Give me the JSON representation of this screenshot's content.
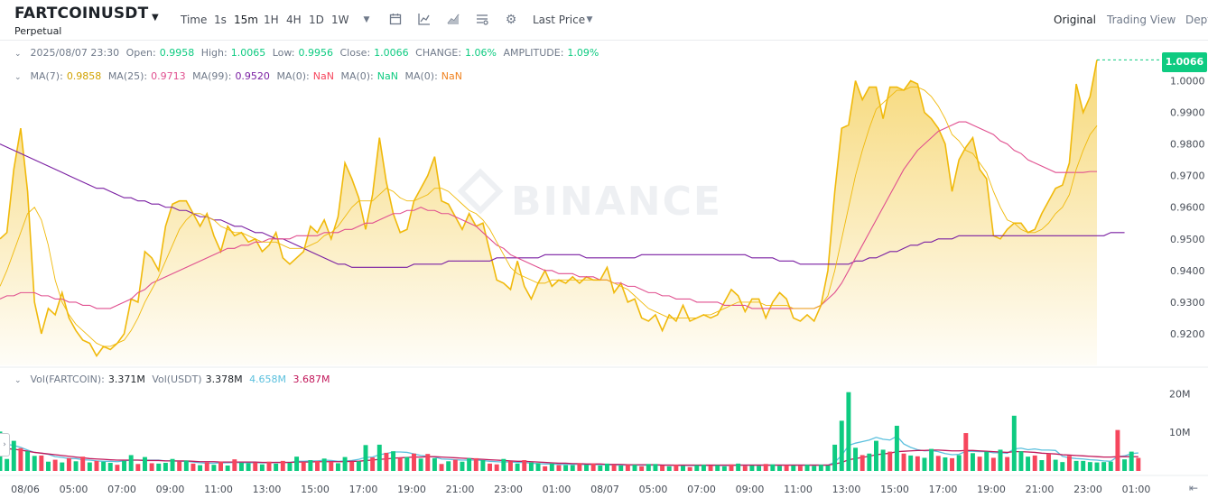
{
  "header": {
    "symbol": "FARTCOINUSDT",
    "contract": "Perpetual",
    "intervals": [
      "Time",
      "1s",
      "15m",
      "1H",
      "4H",
      "1D",
      "1W"
    ],
    "active_interval": "15m",
    "price_type": "Last Price",
    "views": [
      "Original",
      "Trading View",
      "Dept"
    ],
    "active_view": "Original"
  },
  "ohlc": {
    "date": "2025/08/07 23:30",
    "open_label": "Open:",
    "open": "0.9958",
    "high_label": "High:",
    "high": "1.0065",
    "low_label": "Low:",
    "low": "0.9956",
    "close_label": "Close:",
    "close": "1.0066",
    "change_label": "CHANGE:",
    "change": "1.06%",
    "amplitude_label": "AMPLITUDE:",
    "amplitude": "1.09%"
  },
  "ma": {
    "ma7_label": "MA(7):",
    "ma7": "0.9858",
    "ma25_label": "MA(25):",
    "ma25": "0.9713",
    "ma99_label": "MA(99):",
    "ma99": "0.9520",
    "ma0a_label": "MA(0):",
    "ma0a": "NaN",
    "ma0b_label": "MA(0):",
    "ma0b": "NaN",
    "ma0c_label": "MA(0):",
    "ma0c": "NaN"
  },
  "volume": {
    "label": "Vol(FARTCOIN):",
    "value": "3.371M",
    "usdt_label": "Vol(USDT)",
    "usdt_value": "3.378M",
    "ma1": "4.658M",
    "ma2": "3.687M"
  },
  "current_price": "1.0066",
  "watermark": "BINANCE",
  "colors": {
    "up": "#0ecb81",
    "down": "#f6465d",
    "area_line": "#f0b90b",
    "ma7": "#f0b90b",
    "ma25": "#e04f8f",
    "ma99": "#7a1fa2",
    "vol_ma1": "#5bc0de",
    "vol_ma2": "#c2185b"
  },
  "chart_data": {
    "type": "area",
    "y_ticks": [
      "1.0000",
      "0.9900",
      "0.9800",
      "0.9700",
      "0.9600",
      "0.9500",
      "0.9400",
      "0.9300",
      "0.9200"
    ],
    "ylim": [
      0.91,
      1.007
    ],
    "x_ticks": [
      "08/06",
      "05:00",
      "07:00",
      "09:00",
      "11:00",
      "13:00",
      "15:00",
      "17:00",
      "19:00",
      "21:00",
      "23:00",
      "01:00",
      "08/07",
      "05:00",
      "07:00",
      "09:00",
      "11:00",
      "13:00",
      "15:00",
      "17:00",
      "19:00",
      "21:00",
      "23:00",
      "01:00"
    ],
    "vol_ticks": [
      "20M",
      "10M"
    ],
    "vol_max": 25,
    "price": [
      0.95,
      0.952,
      0.972,
      0.985,
      0.965,
      0.93,
      0.92,
      0.928,
      0.926,
      0.933,
      0.925,
      0.921,
      0.918,
      0.917,
      0.913,
      0.916,
      0.915,
      0.917,
      0.92,
      0.931,
      0.93,
      0.946,
      0.944,
      0.94,
      0.954,
      0.961,
      0.962,
      0.962,
      0.958,
      0.954,
      0.958,
      0.951,
      0.946,
      0.954,
      0.951,
      0.952,
      0.949,
      0.95,
      0.946,
      0.948,
      0.952,
      0.944,
      0.942,
      0.944,
      0.946,
      0.954,
      0.952,
      0.956,
      0.95,
      0.957,
      0.974,
      0.969,
      0.963,
      0.953,
      0.964,
      0.982,
      0.968,
      0.958,
      0.952,
      0.953,
      0.962,
      0.966,
      0.97,
      0.976,
      0.962,
      0.961,
      0.957,
      0.953,
      0.958,
      0.954,
      0.955,
      0.946,
      0.937,
      0.936,
      0.934,
      0.943,
      0.935,
      0.931,
      0.936,
      0.94,
      0.935,
      0.937,
      0.936,
      0.938,
      0.936,
      0.938,
      0.937,
      0.937,
      0.941,
      0.933,
      0.936,
      0.93,
      0.931,
      0.925,
      0.924,
      0.926,
      0.921,
      0.926,
      0.924,
      0.929,
      0.924,
      0.925,
      0.926,
      0.925,
      0.926,
      0.93,
      0.934,
      0.932,
      0.927,
      0.931,
      0.931,
      0.925,
      0.93,
      0.933,
      0.931,
      0.925,
      0.924,
      0.926,
      0.924,
      0.929,
      0.94,
      0.965,
      0.985,
      0.986,
      1.0,
      0.994,
      0.998,
      0.998,
      0.988,
      0.998,
      0.998,
      0.997,
      1.0,
      0.999,
      0.99,
      0.988,
      0.985,
      0.98,
      0.965,
      0.975,
      0.979,
      0.982,
      0.972,
      0.969,
      0.951,
      0.95,
      0.953,
      0.955,
      0.955,
      0.952,
      0.953,
      0.958,
      0.962,
      0.966,
      0.967,
      0.974,
      0.999,
      0.99,
      0.995,
      1.0066
    ],
    "ma7": [
      0.935,
      0.94,
      0.946,
      0.952,
      0.958,
      0.96,
      0.956,
      0.948,
      0.937,
      0.93,
      0.926,
      0.923,
      0.921,
      0.919,
      0.917,
      0.916,
      0.916,
      0.917,
      0.918,
      0.921,
      0.925,
      0.93,
      0.934,
      0.938,
      0.943,
      0.948,
      0.953,
      0.956,
      0.958,
      0.958,
      0.957,
      0.956,
      0.954,
      0.953,
      0.952,
      0.952,
      0.951,
      0.95,
      0.949,
      0.949,
      0.949,
      0.948,
      0.947,
      0.947,
      0.947,
      0.948,
      0.949,
      0.951,
      0.952,
      0.954,
      0.957,
      0.96,
      0.962,
      0.962,
      0.962,
      0.964,
      0.966,
      0.965,
      0.963,
      0.962,
      0.962,
      0.963,
      0.964,
      0.966,
      0.966,
      0.965,
      0.963,
      0.961,
      0.959,
      0.958,
      0.956,
      0.953,
      0.949,
      0.945,
      0.941,
      0.939,
      0.938,
      0.937,
      0.936,
      0.936,
      0.937,
      0.937,
      0.937,
      0.937,
      0.937,
      0.937,
      0.937,
      0.937,
      0.937,
      0.936,
      0.935,
      0.934,
      0.932,
      0.93,
      0.928,
      0.927,
      0.926,
      0.925,
      0.925,
      0.925,
      0.925,
      0.925,
      0.926,
      0.926,
      0.927,
      0.928,
      0.929,
      0.93,
      0.93,
      0.93,
      0.93,
      0.929,
      0.929,
      0.929,
      0.929,
      0.928,
      0.928,
      0.928,
      0.928,
      0.929,
      0.932,
      0.94,
      0.95,
      0.96,
      0.97,
      0.978,
      0.985,
      0.991,
      0.993,
      0.995,
      0.997,
      0.997,
      0.998,
      0.998,
      0.997,
      0.995,
      0.992,
      0.988,
      0.983,
      0.981,
      0.978,
      0.977,
      0.974,
      0.971,
      0.965,
      0.96,
      0.956,
      0.955,
      0.953,
      0.952,
      0.952,
      0.953,
      0.955,
      0.958,
      0.96,
      0.964,
      0.972,
      0.978,
      0.983,
      0.9858
    ],
    "ma25": [
      0.931,
      0.932,
      0.932,
      0.933,
      0.933,
      0.933,
      0.932,
      0.932,
      0.931,
      0.931,
      0.93,
      0.93,
      0.929,
      0.929,
      0.928,
      0.928,
      0.928,
      0.929,
      0.93,
      0.931,
      0.933,
      0.934,
      0.936,
      0.937,
      0.938,
      0.939,
      0.94,
      0.941,
      0.942,
      0.943,
      0.944,
      0.945,
      0.946,
      0.947,
      0.947,
      0.948,
      0.948,
      0.949,
      0.949,
      0.95,
      0.95,
      0.95,
      0.95,
      0.951,
      0.951,
      0.951,
      0.951,
      0.952,
      0.952,
      0.952,
      0.953,
      0.953,
      0.954,
      0.955,
      0.955,
      0.956,
      0.957,
      0.958,
      0.958,
      0.959,
      0.959,
      0.96,
      0.959,
      0.959,
      0.958,
      0.958,
      0.957,
      0.956,
      0.955,
      0.954,
      0.952,
      0.95,
      0.948,
      0.947,
      0.945,
      0.944,
      0.943,
      0.942,
      0.941,
      0.94,
      0.94,
      0.939,
      0.939,
      0.939,
      0.938,
      0.938,
      0.938,
      0.937,
      0.937,
      0.936,
      0.936,
      0.935,
      0.935,
      0.934,
      0.933,
      0.933,
      0.932,
      0.932,
      0.931,
      0.931,
      0.931,
      0.93,
      0.93,
      0.93,
      0.93,
      0.929,
      0.929,
      0.929,
      0.929,
      0.928,
      0.928,
      0.928,
      0.928,
      0.928,
      0.928,
      0.928,
      0.928,
      0.928,
      0.928,
      0.929,
      0.931,
      0.933,
      0.936,
      0.94,
      0.944,
      0.948,
      0.952,
      0.956,
      0.96,
      0.964,
      0.968,
      0.972,
      0.975,
      0.978,
      0.98,
      0.982,
      0.984,
      0.985,
      0.986,
      0.987,
      0.987,
      0.986,
      0.985,
      0.984,
      0.983,
      0.981,
      0.98,
      0.978,
      0.977,
      0.975,
      0.974,
      0.973,
      0.972,
      0.971,
      0.971,
      0.971,
      0.971,
      0.971,
      0.9713,
      0.9713
    ],
    "ma99": [
      0.98,
      0.979,
      0.978,
      0.977,
      0.976,
      0.975,
      0.974,
      0.973,
      0.972,
      0.971,
      0.97,
      0.969,
      0.968,
      0.967,
      0.966,
      0.966,
      0.965,
      0.964,
      0.963,
      0.963,
      0.962,
      0.962,
      0.961,
      0.961,
      0.96,
      0.96,
      0.959,
      0.959,
      0.958,
      0.957,
      0.957,
      0.956,
      0.956,
      0.955,
      0.954,
      0.954,
      0.953,
      0.952,
      0.952,
      0.951,
      0.95,
      0.95,
      0.949,
      0.948,
      0.947,
      0.946,
      0.945,
      0.944,
      0.943,
      0.942,
      0.942,
      0.941,
      0.941,
      0.941,
      0.941,
      0.941,
      0.941,
      0.941,
      0.941,
      0.941,
      0.942,
      0.942,
      0.942,
      0.942,
      0.942,
      0.943,
      0.943,
      0.943,
      0.943,
      0.943,
      0.943,
      0.943,
      0.944,
      0.944,
      0.944,
      0.944,
      0.944,
      0.944,
      0.944,
      0.945,
      0.945,
      0.945,
      0.945,
      0.945,
      0.945,
      0.944,
      0.944,
      0.944,
      0.944,
      0.944,
      0.944,
      0.944,
      0.944,
      0.945,
      0.945,
      0.945,
      0.945,
      0.945,
      0.945,
      0.945,
      0.945,
      0.945,
      0.945,
      0.945,
      0.945,
      0.945,
      0.945,
      0.945,
      0.945,
      0.944,
      0.944,
      0.944,
      0.944,
      0.943,
      0.943,
      0.943,
      0.942,
      0.942,
      0.942,
      0.942,
      0.942,
      0.942,
      0.942,
      0.942,
      0.943,
      0.943,
      0.944,
      0.944,
      0.945,
      0.946,
      0.946,
      0.947,
      0.948,
      0.948,
      0.949,
      0.949,
      0.95,
      0.95,
      0.95,
      0.951,
      0.951,
      0.951,
      0.951,
      0.951,
      0.951,
      0.951,
      0.951,
      0.951,
      0.951,
      0.951,
      0.951,
      0.951,
      0.951,
      0.951,
      0.951,
      0.951,
      0.951,
      0.951,
      0.951,
      0.951,
      0.951,
      0.952,
      0.952,
      0.952
    ],
    "volume": [
      10.2,
      3.1,
      7.8,
      5.9,
      5.1,
      3.9,
      4.0,
      2.4,
      2.9,
      2.2,
      3.3,
      2.5,
      3.7,
      2.2,
      2.6,
      2.4,
      2.1,
      1.6,
      2.6,
      4.1,
      1.8,
      3.6,
      2.0,
      1.9,
      2.1,
      3.1,
      2.4,
      2.7,
      1.9,
      1.5,
      2.2,
      1.6,
      2.4,
      1.4,
      3.0,
      2.1,
      2.0,
      2.2,
      1.7,
      2.4,
      1.9,
      2.6,
      2.1,
      3.7,
      2.3,
      2.8,
      2.6,
      3.2,
      2.3,
      2.0,
      3.6,
      2.4,
      2.5,
      6.7,
      3.5,
      6.8,
      4.7,
      5.1,
      3.4,
      3.6,
      4.5,
      3.2,
      4.4,
      3.3,
      1.8,
      2.5,
      2.9,
      2.4,
      3.3,
      3.3,
      2.8,
      1.9,
      1.7,
      3.1,
      2.5,
      1.9,
      2.8,
      2.2,
      2.0,
      1.2,
      1.9,
      1.5,
      1.5,
      1.5,
      2.0,
      1.6,
      1.9,
      1.4,
      1.9,
      1.6,
      1.4,
      1.6,
      1.6,
      1.2,
      1.8,
      1.8,
      1.4,
      1.2,
      1.6,
      1.3,
      1.0,
      1.5,
      1.6,
      1.4,
      1.5,
      1.2,
      1.7,
      1.9,
      1.3,
      1.4,
      1.3,
      1.8,
      1.7,
      1.3,
      1.5,
      1.4,
      1.3,
      1.6,
      1.3,
      1.6,
      1.4,
      6.8,
      13.0,
      20.4,
      6.0,
      4.1,
      4.5,
      7.8,
      5.5,
      5.0,
      11.7,
      4.5,
      4.0,
      3.8,
      3.4,
      5.7,
      3.9,
      3.5,
      3.3,
      4.1,
      9.8,
      4.6,
      3.7,
      5.0,
      3.4,
      5.5,
      3.6,
      14.3,
      5.1,
      3.7,
      4.0,
      2.8,
      4.4,
      2.9,
      2.3,
      3.9,
      2.6,
      2.6,
      2.3,
      2.2,
      2.3,
      2.4,
      10.6,
      3.0,
      5.0,
      3.371
    ],
    "volume_up": [
      1,
      1,
      1,
      0,
      1,
      1,
      0,
      1,
      0,
      1,
      0,
      1,
      0,
      1,
      0,
      1,
      1,
      0,
      1,
      1,
      0,
      1,
      0,
      1,
      1,
      1,
      0,
      1,
      0,
      1,
      0,
      1,
      0,
      1,
      0,
      1,
      1,
      0,
      1,
      0,
      1,
      0,
      1,
      1,
      0,
      1,
      0,
      1,
      0,
      1,
      1,
      0,
      1,
      1,
      0,
      1,
      0,
      1,
      0,
      1,
      0,
      1,
      0,
      1,
      0,
      1,
      0,
      1,
      1,
      0,
      1,
      0,
      0,
      1,
      0,
      1,
      0,
      1,
      1,
      0,
      1,
      0,
      1,
      1,
      0,
      1,
      0,
      1,
      1,
      0,
      1,
      0,
      1,
      0,
      1,
      1,
      0,
      1,
      0,
      1,
      0,
      1,
      1,
      0,
      1,
      1,
      0,
      1,
      0,
      1,
      1,
      0,
      1,
      1,
      0,
      1,
      0,
      1,
      1,
      1,
      1,
      1,
      1,
      1,
      1,
      0,
      1,
      1,
      1,
      0,
      1,
      0,
      1,
      0,
      1,
      1,
      0,
      1,
      0,
      1,
      0,
      1,
      0,
      1,
      0,
      1,
      0,
      1,
      1,
      1,
      0,
      1,
      0,
      1,
      1,
      0,
      1,
      1,
      1,
      1,
      1,
      1,
      0,
      1,
      1
    ],
    "vol_ma1": [
      7.2,
      6.9,
      6.6,
      6.1,
      5.4,
      4.8,
      4.6,
      4.3,
      3.7,
      3.5,
      3.2,
      3.2,
      2.9,
      2.8,
      2.6,
      2.5,
      2.5,
      2.4,
      2.6,
      2.8,
      2.8,
      2.8,
      2.8,
      2.8,
      2.6,
      2.6,
      2.5,
      2.5,
      2.3,
      2.1,
      2.0,
      2.0,
      2.1,
      2.1,
      2.2,
      2.1,
      2.1,
      2.1,
      2.1,
      2.1,
      2.2,
      2.2,
      2.2,
      2.5,
      2.5,
      2.6,
      2.6,
      2.8,
      2.7,
      2.5,
      2.6,
      2.7,
      3.0,
      3.5,
      3.6,
      4.2,
      4.5,
      4.9,
      4.9,
      4.8,
      4.4,
      4.0,
      3.8,
      3.6,
      3.1,
      3.0,
      2.9,
      2.8,
      2.8,
      2.8,
      2.7,
      2.5,
      2.4,
      2.3,
      2.3,
      2.2,
      2.2,
      2.0,
      1.9,
      1.8,
      1.8,
      1.7,
      1.7,
      1.7,
      1.7,
      1.6,
      1.6,
      1.6,
      1.6,
      1.5,
      1.5,
      1.5,
      1.5,
      1.5,
      1.5,
      1.5,
      1.5,
      1.5,
      1.4,
      1.4,
      1.4,
      1.4,
      1.4,
      1.4,
      1.4,
      1.4,
      1.4,
      1.5,
      1.5,
      1.5,
      1.5,
      1.5,
      1.5,
      1.5,
      1.5,
      1.5,
      1.5,
      1.5,
      1.5,
      1.5,
      1.5,
      2.3,
      4.0,
      6.6,
      7.2,
      7.6,
      8.0,
      8.7,
      8.2,
      8.0,
      9.0,
      7.0,
      6.1,
      5.5,
      5.2,
      5.3,
      5.0,
      4.5,
      4.2,
      4.3,
      5.1,
      5.1,
      5.0,
      5.0,
      4.7,
      4.7,
      4.6,
      5.7,
      5.9,
      5.5,
      5.7,
      5.4,
      5.4,
      5.3,
      3.8,
      3.4,
      3.2,
      3.1,
      2.9,
      2.8,
      2.6,
      2.5,
      3.7,
      3.9,
      4.5,
      4.658
    ],
    "vol_ma2": [
      6.0,
      5.8,
      5.6,
      5.4,
      5.1,
      4.8,
      4.6,
      4.4,
      4.2,
      4.0,
      3.8,
      3.6,
      3.4,
      3.2,
      3.1,
      3.0,
      2.9,
      2.8,
      2.8,
      2.8,
      2.8,
      2.7,
      2.7,
      2.7,
      2.6,
      2.6,
      2.6,
      2.6,
      2.5,
      2.4,
      2.4,
      2.4,
      2.3,
      2.3,
      2.3,
      2.3,
      2.3,
      2.3,
      2.2,
      2.2,
      2.2,
      2.2,
      2.2,
      2.3,
      2.3,
      2.3,
      2.4,
      2.4,
      2.4,
      2.4,
      2.4,
      2.5,
      2.5,
      2.7,
      2.8,
      3.0,
      3.1,
      3.3,
      3.4,
      3.5,
      3.6,
      3.6,
      3.7,
      3.7,
      3.6,
      3.5,
      3.4,
      3.3,
      3.2,
      3.1,
      3.0,
      2.9,
      2.8,
      2.7,
      2.6,
      2.5,
      2.5,
      2.4,
      2.3,
      2.2,
      2.1,
      2.0,
      2.0,
      1.9,
      1.9,
      1.8,
      1.8,
      1.8,
      1.7,
      1.7,
      1.7,
      1.6,
      1.6,
      1.6,
      1.6,
      1.6,
      1.5,
      1.5,
      1.5,
      1.5,
      1.5,
      1.5,
      1.5,
      1.5,
      1.5,
      1.5,
      1.5,
      1.5,
      1.5,
      1.5,
      1.5,
      1.5,
      1.5,
      1.5,
      1.5,
      1.5,
      1.5,
      1.5,
      1.5,
      1.5,
      1.5,
      1.8,
      2.2,
      2.9,
      3.2,
      3.5,
      3.8,
      4.2,
      4.4,
      4.6,
      5.0,
      5.1,
      5.2,
      5.3,
      5.3,
      5.4,
      5.4,
      5.3,
      5.2,
      5.2,
      5.3,
      5.3,
      5.2,
      5.1,
      5.0,
      4.9,
      4.8,
      5.0,
      5.0,
      4.9,
      4.8,
      4.6,
      4.5,
      4.4,
      4.2,
      4.1,
      4.0,
      3.9,
      3.8,
      3.7,
      3.6,
      3.6,
      3.7,
      3.7,
      3.7,
      3.687
    ]
  }
}
